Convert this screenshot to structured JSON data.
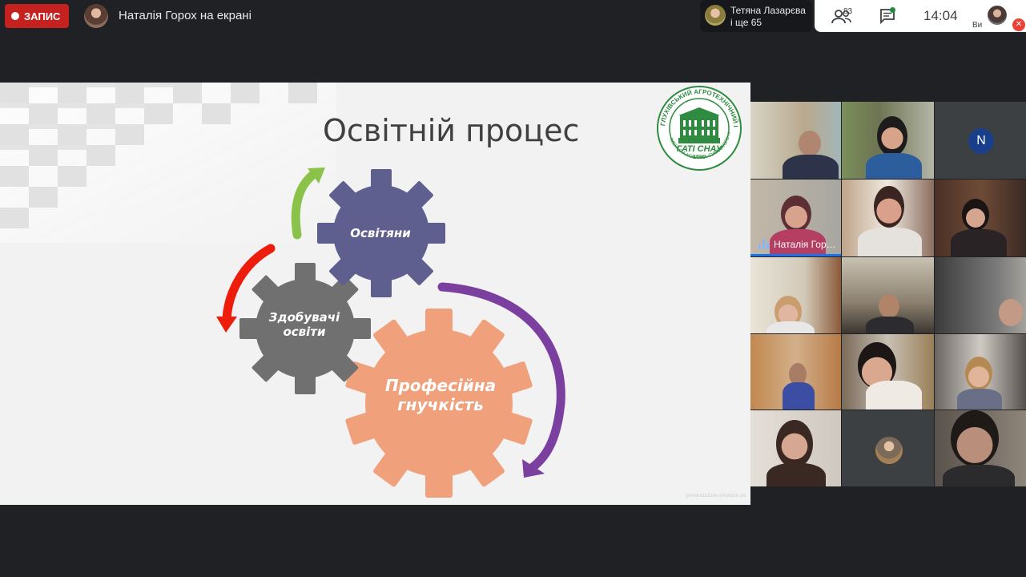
{
  "topbar": {
    "record_label": "ЗАПИС",
    "presenter_text": "Наталія Горох на екрані"
  },
  "speaker": {
    "name": "Тетяна Лазарєва",
    "more": "і ще 65"
  },
  "controls": {
    "people_icon": "people-icon",
    "people_count": "83",
    "chat_icon": "chat-icon",
    "time": "14:04",
    "self_label": "Ви",
    "mic_status": "muted"
  },
  "slide": {
    "title": "Освітній процес",
    "gears": {
      "top": "Освітяни",
      "left": "Здобувачі освіти",
      "big": "Професійна гнучкість"
    },
    "logo": {
      "ring_text": "ГЛУХІВСЬКИЙ АГРОТЕХНІЧНИЙ ІНСТИТУТ",
      "abbr": "ГАТІ СНАУ",
      "year": "1899",
      "sub": "ІМЕНІ С.А.КОВПАКА СУМСЬКОГО НАУ"
    },
    "footer": "presentation-creation.ru",
    "colors": {
      "gear_top": "#5f5f8f",
      "gear_left": "#6e6e6e",
      "gear_big": "#f0a07a",
      "arrow_green": "#8bc34a",
      "arrow_red": "#ee1c0a",
      "arrow_purple": "#7b3fa0",
      "logo_green": "#2e8b3f"
    }
  },
  "participants": [
    {
      "name": ""
    },
    {
      "name": ""
    },
    {
      "name": "",
      "initial": "N"
    },
    {
      "name": "Наталія Гор…",
      "speaking": true
    },
    {
      "name": ""
    },
    {
      "name": ""
    },
    {
      "name": ""
    },
    {
      "name": ""
    },
    {
      "name": ""
    },
    {
      "name": ""
    },
    {
      "name": ""
    },
    {
      "name": ""
    },
    {
      "name": ""
    },
    {
      "name": ""
    },
    {
      "name": ""
    }
  ]
}
